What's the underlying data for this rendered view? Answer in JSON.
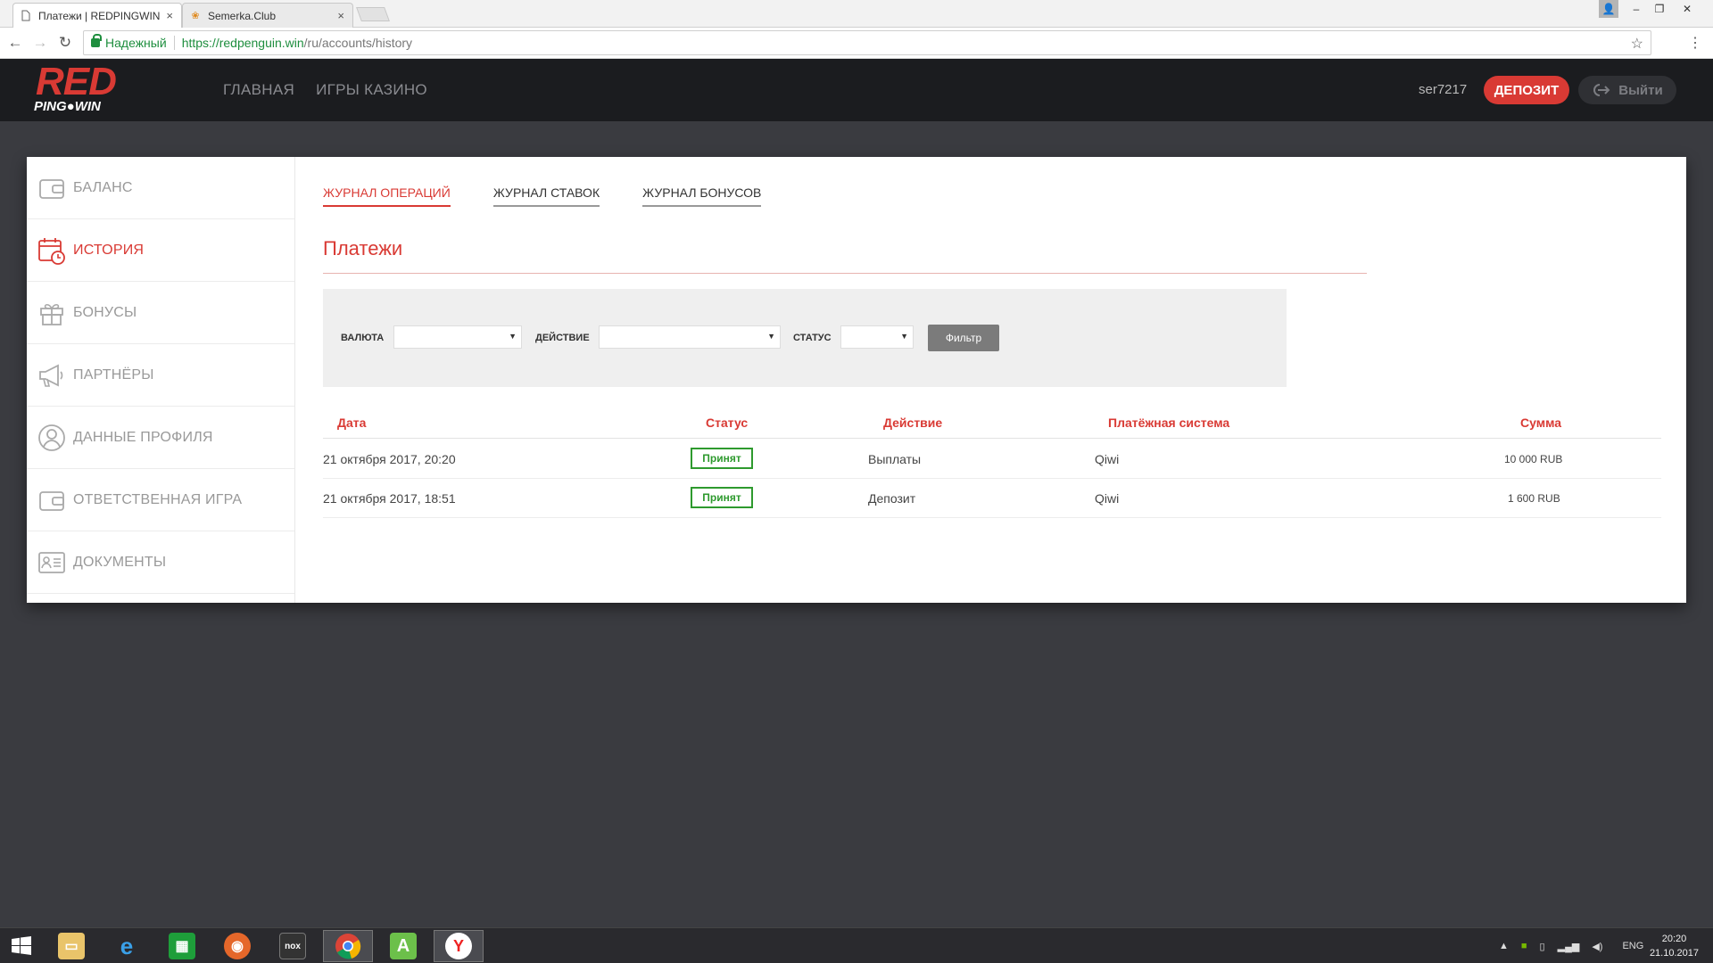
{
  "browser": {
    "tabs": [
      {
        "title": "Платежи | REDPINGWIN",
        "icon": "page-icon"
      },
      {
        "title": "Semerka.Club",
        "icon": "semerka-icon"
      }
    ],
    "secure_label": "Надежный",
    "url_main": "https://redpenguin.win",
    "url_path": "/ru/accounts/history"
  },
  "site": {
    "logo_top": "RED",
    "logo_bottom": "PING●WIN",
    "nav": [
      "ГЛАВНАЯ",
      "ИГРЫ КАЗИНО"
    ],
    "username": "ser7217",
    "deposit_label": "ДЕПОЗИТ",
    "logout_label": "Выйти"
  },
  "sidebar": {
    "items": [
      {
        "label": "БАЛАНС",
        "icon": "wallet-icon"
      },
      {
        "label": "ИСТОРИЯ",
        "icon": "calendar-clock-icon",
        "active": true
      },
      {
        "label": "БОНУСЫ",
        "icon": "gift-icon"
      },
      {
        "label": "ПАРТНЁРЫ",
        "icon": "megaphone-icon"
      },
      {
        "label": "ДАННЫЕ ПРОФИЛЯ",
        "icon": "profile-icon"
      },
      {
        "label": "ОТВЕТСТВЕННАЯ ИГРА",
        "icon": "wallet-icon"
      },
      {
        "label": "ДОКУМЕНТЫ",
        "icon": "id-card-icon"
      }
    ]
  },
  "main": {
    "tabs": [
      "ЖУРНАЛ ОПЕРАЦИЙ",
      "ЖУРНАЛ СТАВОК",
      "ЖУРНАЛ БОНУСОВ"
    ],
    "title": "Платежи",
    "filter": {
      "currency_label": "ВАЛЮТА",
      "action_label": "ДЕЙСТВИЕ",
      "status_label": "СТАТУС",
      "button_label": "Фильтр"
    },
    "table": {
      "headers": [
        "Дата",
        "Статус",
        "Действие",
        "Платёжная система",
        "Сумма"
      ],
      "rows": [
        {
          "date": "21 октября 2017, 20:20",
          "status": "Принят",
          "action": "Выплаты",
          "system": "Qiwi",
          "sum": "10 000 RUB"
        },
        {
          "date": "21 октября 2017, 18:51",
          "status": "Принят",
          "action": "Депозит",
          "system": "Qiwi",
          "sum": "1 600 RUB"
        }
      ]
    }
  },
  "taskbar": {
    "lang": "ENG",
    "time": "20:20",
    "date": "21.10.2017"
  },
  "colors": {
    "accent": "#d93a34",
    "success": "#2e9a2e",
    "header_bg": "#1b1c1f",
    "page_bg": "#3a3b40"
  }
}
